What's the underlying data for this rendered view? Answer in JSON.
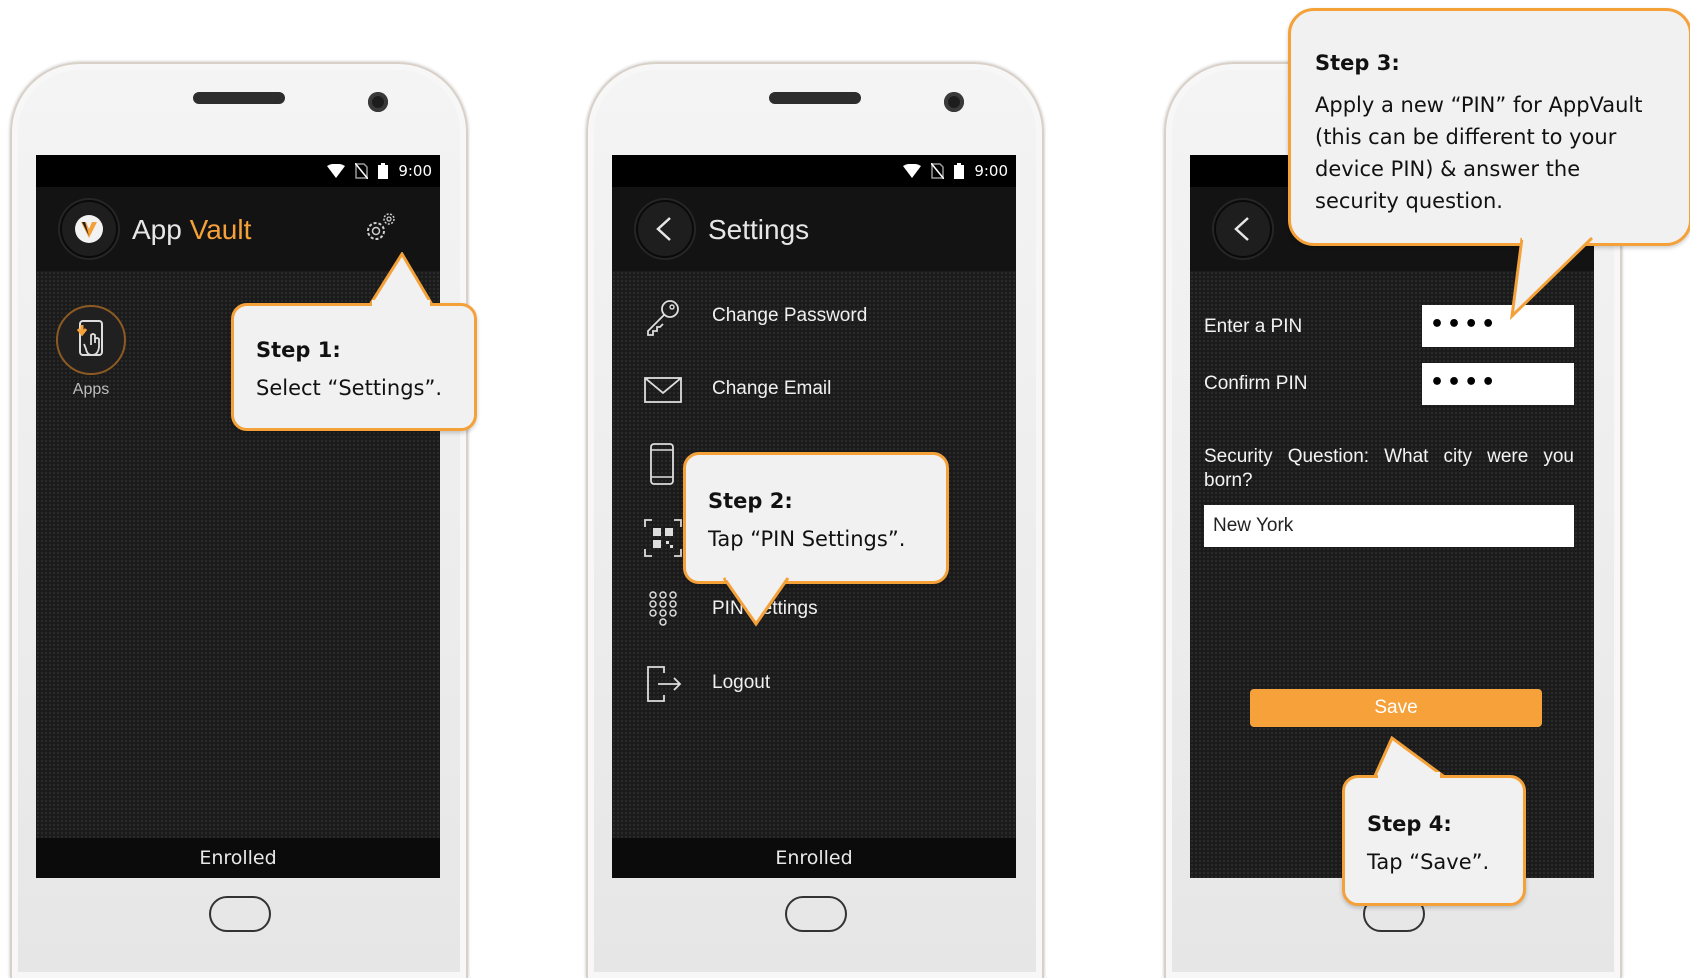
{
  "phone1": {
    "status_time": "9:00",
    "app_name_part1": "App",
    "app_name_part2": "Vault",
    "apps_label": "Apps",
    "footer": "Enrolled"
  },
  "phone2": {
    "status_time": "9:00",
    "title": "Settings",
    "menu": [
      {
        "label": "Change Password",
        "icon": "key-icon"
      },
      {
        "label": "Change Email",
        "icon": "envelope-icon"
      },
      {
        "label": "",
        "icon": "phone-device-icon"
      },
      {
        "label": "",
        "icon": "qr-scan-icon"
      },
      {
        "label": "PIN Settings",
        "icon": "keypad-icon"
      },
      {
        "label": "Logout",
        "icon": "logout-icon"
      }
    ],
    "footer": "Enrolled"
  },
  "phone3": {
    "enter_pin_label": "Enter a PIN",
    "enter_pin_value": "••••",
    "confirm_pin_label": "Confirm PIN",
    "confirm_pin_value": "••••",
    "security_question": "Security Question: What city were you born?",
    "security_answer": "New York",
    "save_label": "Save"
  },
  "callouts": {
    "step1_title": "Step 1:",
    "step1_text": "Select “Settings”.",
    "step2_title": "Step 2:",
    "step2_text": "Tap “PIN Settings”.",
    "step3_title": "Step 3:",
    "step3_line1": "Apply a new “PIN” for AppVault",
    "step3_line2": "(this can be different to your",
    "step3_line3": "device PIN) & answer the",
    "step3_line4": "security question.",
    "step4_title": "Step 4:",
    "step4_text": "Tap “Save”."
  },
  "colors": {
    "accent": "#f4a13a",
    "save_button": "#f7a13b",
    "screen_bg": "#1b1b1b"
  }
}
